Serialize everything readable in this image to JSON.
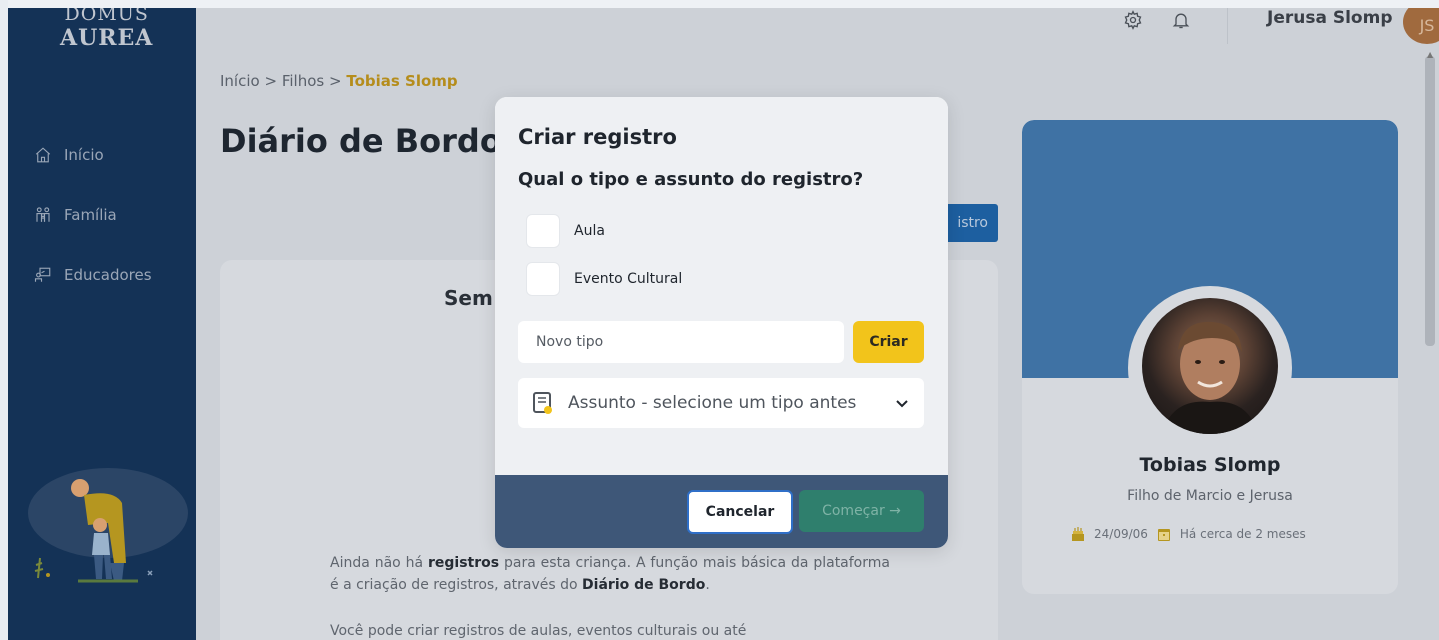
{
  "sidebar": {
    "logo_line1": "DOMUS",
    "logo_line2": "AUREA",
    "items": [
      {
        "label": "Início",
        "icon": "home-icon"
      },
      {
        "label": "Família",
        "icon": "family-icon"
      },
      {
        "label": "Educadores",
        "icon": "educators-icon"
      }
    ]
  },
  "topbar": {
    "user_name": "Jerusa Slomp",
    "user_initials": "JS"
  },
  "breadcrumb": {
    "home": "Início",
    "separator": ">",
    "section": "Filhos",
    "current": "Tobias Slomp"
  },
  "page": {
    "title": "Diário de Bordo",
    "new_record_button": "istro"
  },
  "empty_state": {
    "title": "Sem",
    "p1_a": "Ainda não há ",
    "p1_b": "registros",
    "p1_c": " para esta criança. A função mais básica da plataforma é a criação de registros, através do ",
    "p1_d": "Diário de Bordo",
    "p1_e": ".",
    "p2": "Você pode criar registros de aulas, eventos culturais ou até"
  },
  "profile": {
    "name": "Tobias Slomp",
    "parents": "Filho de Marcio e Jerusa",
    "birthdate": "24/09/06",
    "since": "Há cerca de 2 meses"
  },
  "modal": {
    "title": "Criar registro",
    "question": "Qual o tipo e assunto do registro?",
    "options": [
      {
        "label": "Aula",
        "checked": false
      },
      {
        "label": "Evento Cultural",
        "checked": false
      }
    ],
    "new_type_placeholder": "Novo tipo",
    "create_button": "Criar",
    "subject_placeholder": "Assunto - selecione um tipo antes",
    "cancel_button": "Cancelar",
    "start_button": "Começar →"
  },
  "colors": {
    "sidebar_bg": "#143256",
    "accent_blue": "#2f6fc8",
    "create_yellow": "#f2c41b",
    "start_green": "#2f7f6d",
    "breadcrumb_current": "#b58d1c"
  }
}
